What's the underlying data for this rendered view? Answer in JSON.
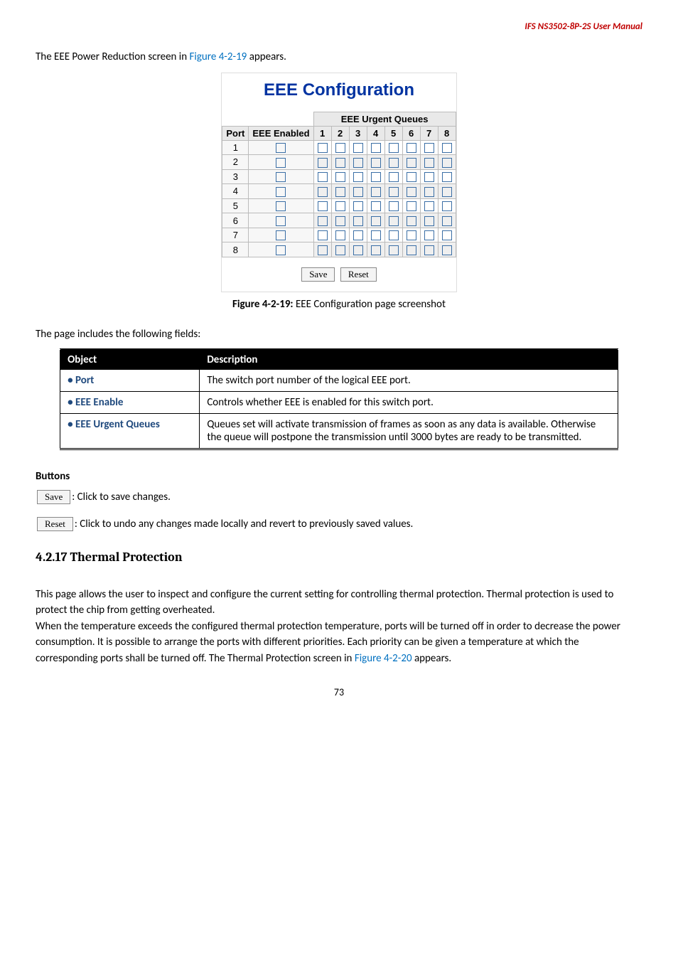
{
  "header": {
    "product": "IFS NS3502-8P-2S  User  Manual"
  },
  "intro": {
    "prefix": "The EEE Power Reduction screen in ",
    "figref": "Figure 4-2-19",
    "suffix": " appears."
  },
  "figure": {
    "title": "EEE Configuration",
    "headers": {
      "spanner": "EEE Urgent Queues",
      "port": "Port",
      "eee_enabled": "EEE Enabled",
      "q": [
        "1",
        "2",
        "3",
        "4",
        "5",
        "6",
        "7",
        "8"
      ]
    },
    "rows": [
      "1",
      "2",
      "3",
      "4",
      "5",
      "6",
      "7",
      "8"
    ],
    "buttons": {
      "save": "Save",
      "reset": "Reset"
    }
  },
  "caption": {
    "bold": "Figure 4-2-19:",
    "rest": " EEE Configuration page screenshot"
  },
  "fields_intro": "The page includes the following fields:",
  "table": {
    "hdr_object": "Object",
    "hdr_desc": "Description",
    "rows": [
      {
        "obj": "Port",
        "desc": "The switch port number of the logical EEE port."
      },
      {
        "obj": "EEE Enable",
        "desc": "Controls whether EEE is enabled for this switch port."
      },
      {
        "obj": "EEE Urgent Queues",
        "desc": "Queues set will activate transmission of frames as soon as any data is available. Otherwise the queue will postpone the transmission until 3000 bytes are ready to be transmitted."
      }
    ]
  },
  "buttons_section": {
    "heading": "Buttons",
    "save_btn": "Save",
    "save_text": ": Click to save changes.",
    "reset_btn": "Reset",
    "reset_text": ": Click to undo any changes made locally and revert to previously saved values."
  },
  "thermal": {
    "heading": "4.2.17 Thermal Protection",
    "p_prefix": "This page allows the user to inspect and configure the current setting for controlling thermal protection. Thermal protection is used to protect the chip from getting overheated.\nWhen the temperature exceeds the configured thermal protection temperature, ports will be turned off in order to decrease the power consumption. It is possible to arrange the ports with different priorities. Each priority can be given a temperature at which the corresponding ports shall be turned off. The Thermal Protection screen in ",
    "figref": "Figure 4-2-20",
    "p_suffix": " appears."
  },
  "page_number": "73"
}
